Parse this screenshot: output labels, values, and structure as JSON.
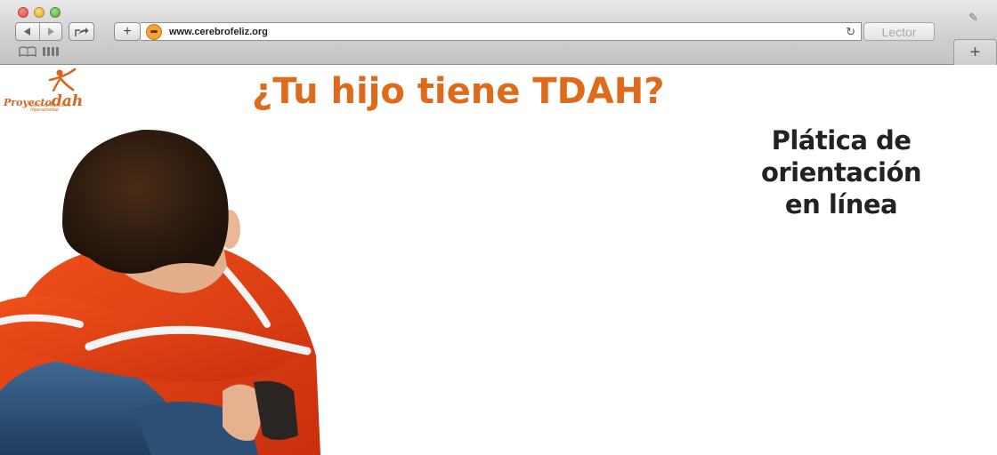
{
  "browser": {
    "url": "www.cerebrofeliz.org",
    "reader_label": "Lector",
    "new_tab_symbol": "+",
    "icons": [
      "close-icon",
      "minimize-icon",
      "zoom-icon",
      "back-arrow-icon",
      "forward-arrow-icon",
      "share-icon",
      "add-icon",
      "favicon-icon",
      "reload-icon",
      "pin-icon",
      "bookmarks-icon",
      "top-sites-icon"
    ]
  },
  "page": {
    "logo": {
      "prefix": "Proyecto",
      "brand": "dah",
      "tagline": "Déficit de Atención e Hiperactividad",
      "color": "#d9641c"
    },
    "headline": "¿Tu hijo tiene TDAH?",
    "subheadline_line1": "Plática de orientación",
    "subheadline_line2": "en línea",
    "headline_color": "#de6a1c",
    "subheadline_color": "#222222",
    "photo": "boy-hiding-face-photo"
  }
}
